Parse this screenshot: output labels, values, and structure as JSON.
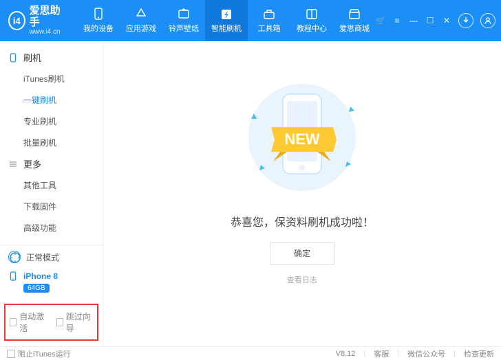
{
  "brand": {
    "logo_text": "i4",
    "title": "爱思助手",
    "url": "www.i4.cn"
  },
  "nav": {
    "items": [
      {
        "label": "我的设备",
        "icon": "phone"
      },
      {
        "label": "应用游戏",
        "icon": "apps"
      },
      {
        "label": "铃声壁纸",
        "icon": "ringtone"
      },
      {
        "label": "智能刷机",
        "icon": "flash",
        "active": true
      },
      {
        "label": "工具箱",
        "icon": "toolbox"
      },
      {
        "label": "教程中心",
        "icon": "book"
      },
      {
        "label": "爱思商城",
        "icon": "store"
      }
    ]
  },
  "sidebar": {
    "groups": [
      {
        "label": "刷机",
        "icon": "phone",
        "items": [
          {
            "label": "iTunes刷机"
          },
          {
            "label": "一键刷机",
            "active": true
          },
          {
            "label": "专业刷机"
          },
          {
            "label": "批量刷机"
          }
        ]
      },
      {
        "label": "更多",
        "icon": "list",
        "items": [
          {
            "label": "其他工具"
          },
          {
            "label": "下载固件"
          },
          {
            "label": "高级功能"
          }
        ]
      }
    ],
    "mode": "正常模式",
    "device": {
      "name": "iPhone 8",
      "capacity": "64GB"
    },
    "redbox": {
      "auto_activate": "自动激活",
      "skip_wizard": "跳过向导"
    }
  },
  "main": {
    "badge_text": "NEW",
    "success_title": "恭喜您，保资料刷机成功啦！",
    "confirm": "确定",
    "view_log": "查看日志"
  },
  "footer": {
    "block_itunes": "阻止iTunes运行",
    "version": "V8.12",
    "support": "客服",
    "wechat": "微信公众号",
    "update": "检查更新"
  }
}
